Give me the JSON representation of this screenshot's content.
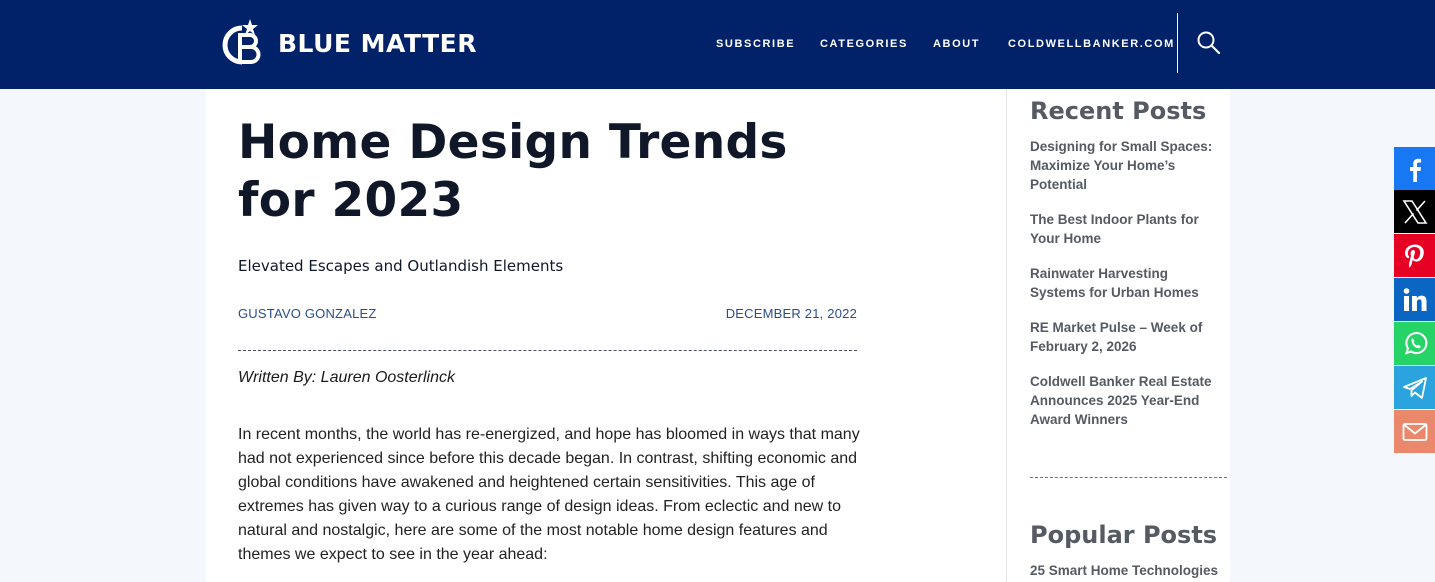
{
  "brand": {
    "name": "BLUE MATTER",
    "logo_icon": "coldwell-banker-cb-icon"
  },
  "nav": {
    "items": [
      "SUBSCRIBE",
      "CATEGORIES",
      "ABOUT",
      "COLDWELLBANKER.COM"
    ],
    "search_icon": "search-icon"
  },
  "article": {
    "title": "Home Design Trends for 2023",
    "subtitle": "Elevated Escapes and Outlandish Elements",
    "author": "GUSTAVO GONZALEZ",
    "date": "DECEMBER 21, 2022",
    "byline": "Written By: Lauren Oosterlinck",
    "intro": "In recent months, the world has re-energized, and hope has bloomed in ways that many had not experienced since before this decade began. In contrast, shifting economic and global conditions have awakened and heightened certain sensitivities. This age of extremes has given way to a curious range of design ideas. From eclectic and new to natural and nostalgic, here are some of the most notable home design features and themes we expect to see in the year ahead:"
  },
  "sidebar": {
    "recent_heading": "Recent Posts",
    "recent": [
      "Designing for Small Spaces: Maximize Your Home’s Potential",
      "The Best Indoor Plants for Your Home",
      "Rainwater Harvesting Systems for Urban Homes",
      "RE Market Pulse – Week of February 2, 2026",
      "Coldwell Banker Real Estate Announces 2025 Year-End Award Winners"
    ],
    "popular_heading": "Popular Posts",
    "popular": [
      "25 Smart Home Technologies"
    ]
  },
  "share": {
    "buttons": [
      {
        "icon": "facebook-icon",
        "color": "#1877f2"
      },
      {
        "icon": "x-twitter-icon",
        "color": "#000000"
      },
      {
        "icon": "pinterest-icon",
        "color": "#e60023"
      },
      {
        "icon": "linkedin-icon",
        "color": "#0a66c2"
      },
      {
        "icon": "whatsapp-icon",
        "color": "#25d366"
      },
      {
        "icon": "telegram-icon",
        "color": "#2aa3de"
      },
      {
        "icon": "email-icon",
        "color": "#e9886b"
      }
    ]
  },
  "colors": {
    "header": "#012169",
    "accent_link": "#2b4d8c"
  }
}
